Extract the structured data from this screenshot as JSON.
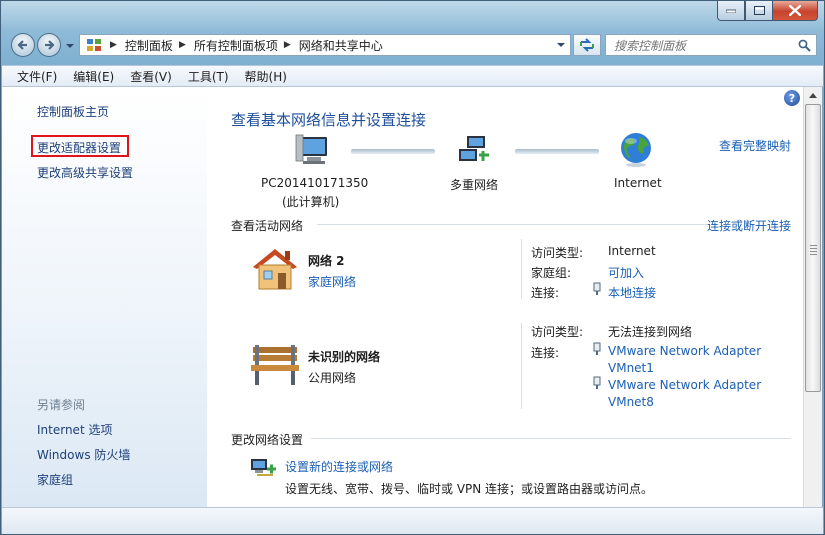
{
  "window": {
    "minimize_label": "minimize",
    "maximize_label": "maximize",
    "close_label": "close"
  },
  "address": {
    "crumbs": [
      "控制面板",
      "所有控制面板项",
      "网络和共享中心"
    ]
  },
  "search": {
    "placeholder": "搜索控制面板"
  },
  "menu": [
    "文件(F)",
    "编辑(E)",
    "查看(V)",
    "工具(T)",
    "帮助(H)"
  ],
  "sidebar": {
    "home": "控制面板主页",
    "change_adapter": "更改适配器设置",
    "change_sharing": "更改高级共享设置",
    "see_also": "另请参阅",
    "links": [
      "Internet 选项",
      "Windows 防火墙",
      "家庭组"
    ]
  },
  "main": {
    "title": "查看基本网络信息并设置连接",
    "view_full_map": "查看完整映射",
    "map": {
      "computer_name": "PC201410171350",
      "computer_sub": "(此计算机)",
      "multi_network": "多重网络",
      "internet": "Internet"
    },
    "active_header": "查看活动网络",
    "connect_disconnect": "连接或断开连接",
    "networks": [
      {
        "name": "网络  2",
        "category": "家庭网络",
        "access_label": "访问类型:",
        "access_value": "Internet",
        "homegroup_label": "家庭组:",
        "homegroup_value": "可加入",
        "connections_label": "连接:",
        "connection_1": "本地连接"
      },
      {
        "name": "未识别的网络",
        "category": "公用网络",
        "access_label": "访问类型:",
        "access_value": "无法连接到网络",
        "connections_label": "连接:",
        "connection_1": "VMware Network Adapter",
        "connection_1b": "VMnet1",
        "connection_2": "VMware Network Adapter",
        "connection_2b": "VMnet8"
      }
    ],
    "change_header": "更改网络设置",
    "setup_link": "设置新的连接或网络",
    "setup_desc": "设置无线、宽带、拨号、临时或 VPN 连接；或设置路由器或访问点。"
  }
}
